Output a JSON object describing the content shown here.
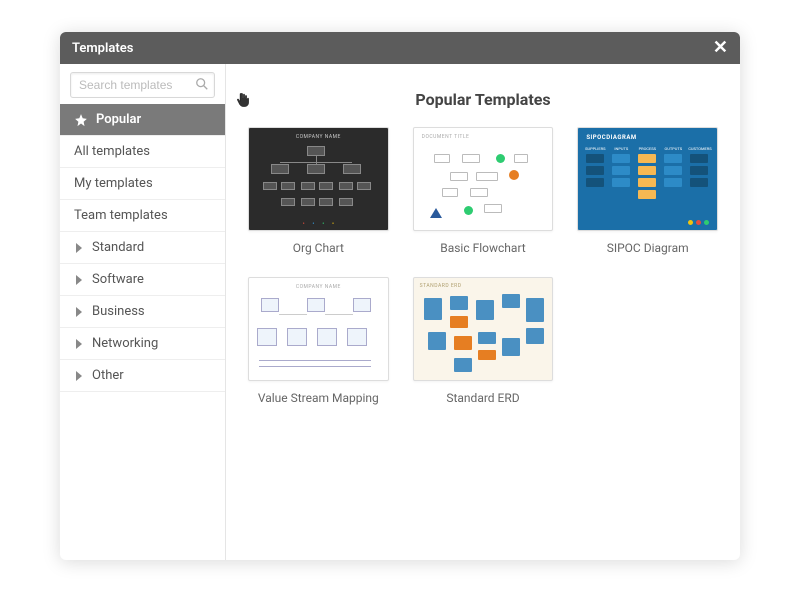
{
  "header": {
    "title": "Templates"
  },
  "search": {
    "placeholder": "Search templates"
  },
  "sidebar": {
    "items": [
      {
        "label": "Popular",
        "type": "star",
        "active": true
      },
      {
        "label": "All templates",
        "type": "plain"
      },
      {
        "label": "My templates",
        "type": "plain"
      },
      {
        "label": "Team templates",
        "type": "plain"
      },
      {
        "label": "Standard",
        "type": "expand"
      },
      {
        "label": "Software",
        "type": "expand"
      },
      {
        "label": "Business",
        "type": "expand"
      },
      {
        "label": "Networking",
        "type": "expand"
      },
      {
        "label": "Other",
        "type": "expand"
      }
    ]
  },
  "main": {
    "title": "Popular Templates",
    "templates": [
      {
        "label": "Org Chart",
        "thumb_title": "COMPANY NAME"
      },
      {
        "label": "Basic Flowchart",
        "thumb_title": "DOCUMENT TITLE"
      },
      {
        "label": "SIPOC Diagram",
        "thumb_title": "SIPOCDIAGRAM"
      },
      {
        "label": "Value Stream Mapping",
        "thumb_title": "COMPANY NAME"
      },
      {
        "label": "Standard ERD",
        "thumb_title": "STANDARD ERD"
      }
    ]
  }
}
